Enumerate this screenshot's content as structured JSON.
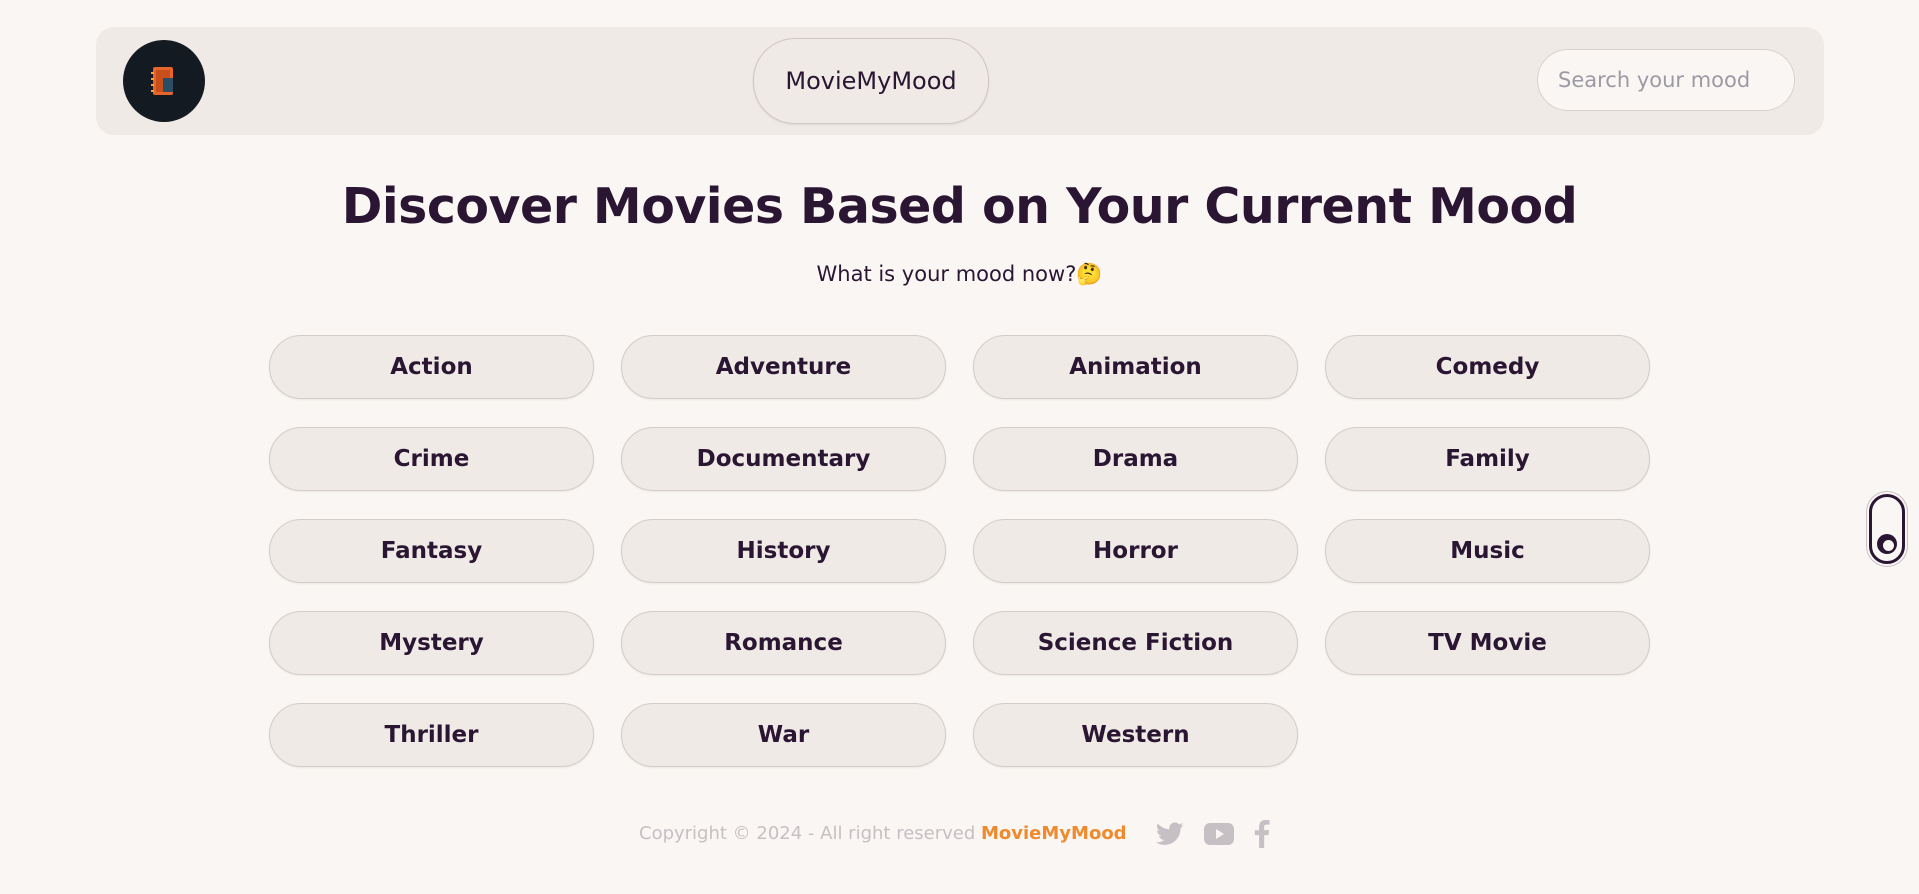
{
  "header": {
    "brand": "MovieMyMood",
    "search_placeholder": "Search your mood"
  },
  "main": {
    "title": "Discover Movies Based on Your Current Mood",
    "subtitle": "What is your mood now?",
    "subtitle_emoji": "🤔",
    "genres": [
      "Action",
      "Adventure",
      "Animation",
      "Comedy",
      "Crime",
      "Documentary",
      "Drama",
      "Family",
      "Fantasy",
      "History",
      "Horror",
      "Music",
      "Mystery",
      "Romance",
      "Science Fiction",
      "TV Movie",
      "Thriller",
      "War",
      "Western"
    ]
  },
  "footer": {
    "copyright": "Copyright © 2024 - All right reserved ",
    "brand": "MovieMyMood",
    "social_icons": [
      "twitter-icon",
      "youtube-icon",
      "facebook-icon"
    ]
  },
  "colors": {
    "background": "#faf6f3",
    "surface": "#efeae6",
    "text": "#2a1633",
    "accent": "#f08a2f",
    "muted": "#c6bfc3"
  }
}
